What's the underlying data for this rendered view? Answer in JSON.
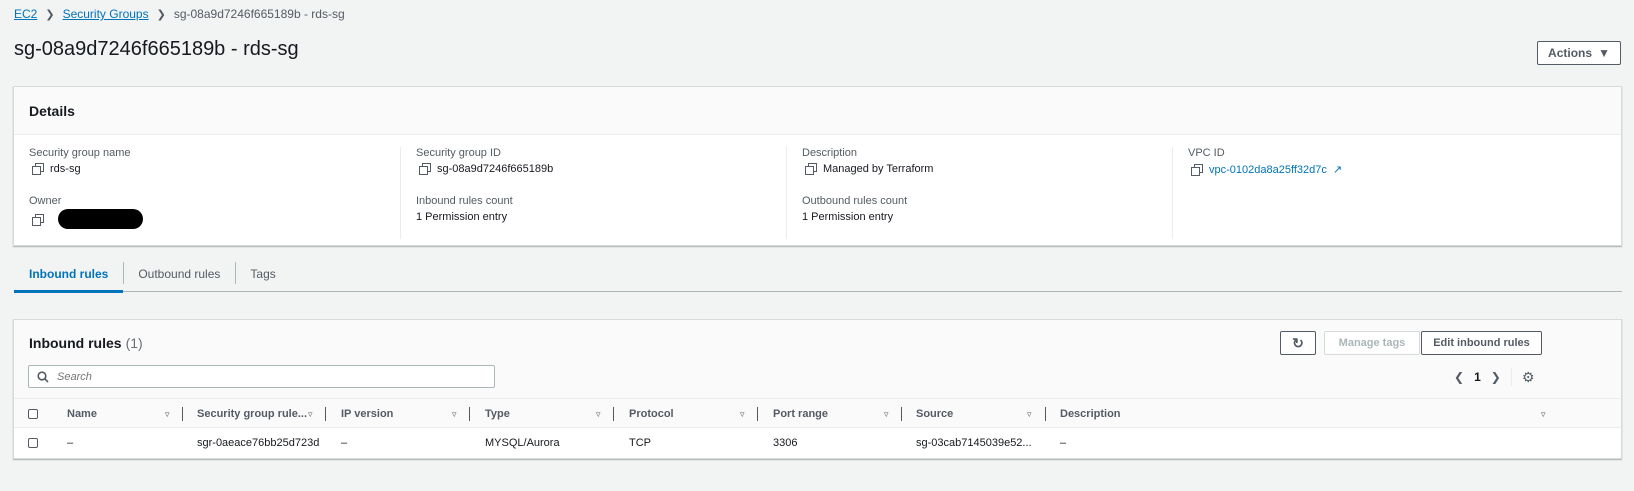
{
  "breadcrumb": {
    "items": [
      {
        "label": "EC2"
      },
      {
        "label": "Security Groups"
      }
    ],
    "current": "sg-08a9d7246f665189b - rds-sg"
  },
  "page": {
    "title": "sg-08a9d7246f665189b - rds-sg",
    "actions_label": "Actions"
  },
  "details": {
    "heading": "Details",
    "sg_name_label": "Security group name",
    "sg_name_value": "rds-sg",
    "sg_id_label": "Security group ID",
    "sg_id_value": "sg-08a9d7246f665189b",
    "description_label": "Description",
    "description_value": "Managed by Terraform",
    "vpc_label": "VPC ID",
    "vpc_value": "vpc-0102da8a25ff32d7c",
    "owner_label": "Owner",
    "inbound_count_label": "Inbound rules count",
    "inbound_count_value": "1 Permission entry",
    "outbound_count_label": "Outbound rules count",
    "outbound_count_value": "1 Permission entry"
  },
  "tabs": [
    {
      "label": "Inbound rules",
      "active": true
    },
    {
      "label": "Outbound rules",
      "active": false
    },
    {
      "label": "Tags",
      "active": false
    }
  ],
  "inbound": {
    "title": "Inbound rules",
    "count": "(1)",
    "manage_tags_label": "Manage tags",
    "edit_label": "Edit inbound rules",
    "search_placeholder": "Search",
    "page_number": "1",
    "columns": [
      "Name",
      "Security group rule...",
      "IP version",
      "Type",
      "Protocol",
      "Port range",
      "Source",
      "Description"
    ],
    "rows": [
      [
        "–",
        "sgr-0aeace76bb25d723d",
        "–",
        "MYSQL/Aurora",
        "TCP",
        "3306",
        "sg-03cab7145039e52...",
        "–"
      ]
    ]
  }
}
